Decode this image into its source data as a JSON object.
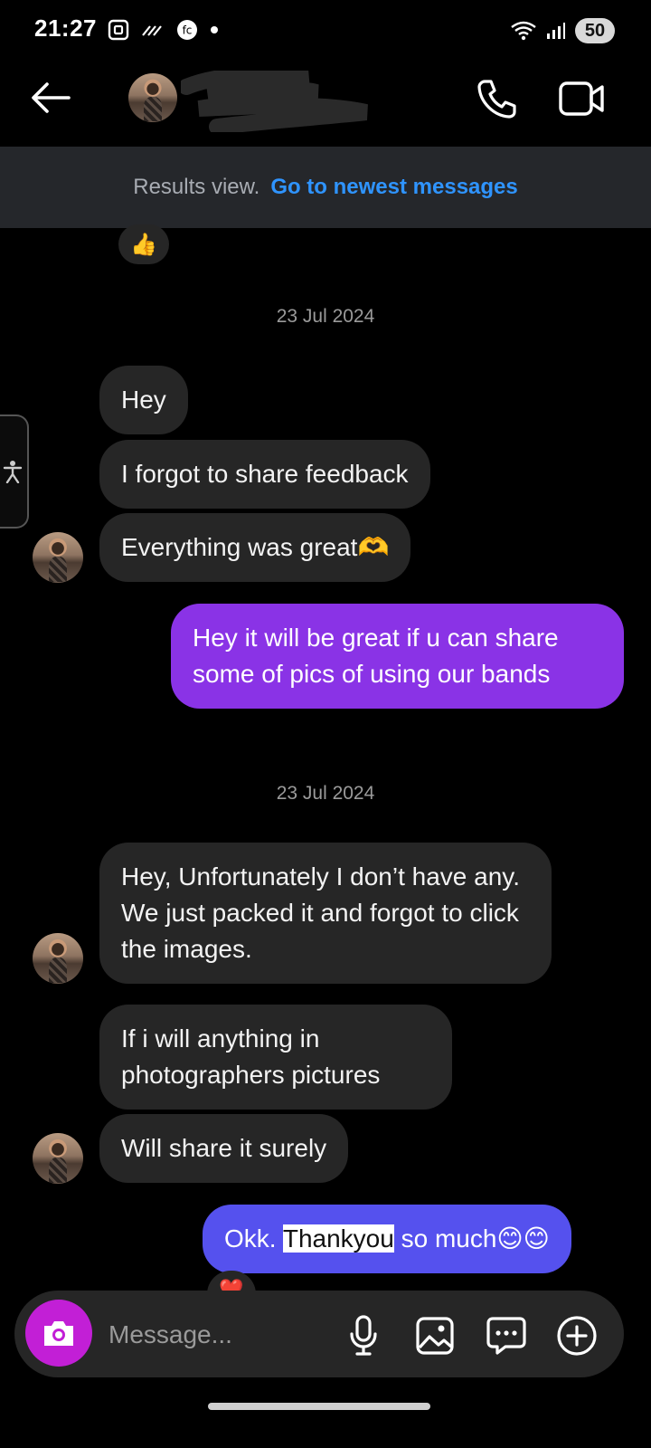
{
  "status_bar": {
    "time": "21:27",
    "battery": "50",
    "icons": [
      "screen-record-icon",
      "wave-icon",
      "fc-icon",
      "dot-icon",
      "wifi-icon",
      "signal-icon"
    ]
  },
  "header": {
    "contact_name": ""
  },
  "banner": {
    "text": "Results view.",
    "link": "Go to newest messages"
  },
  "conversation": {
    "reaction": "👍",
    "dates": [
      "23 Jul 2024",
      "23 Jul 2024"
    ],
    "messages": [
      {
        "from": "them",
        "text": "Hey"
      },
      {
        "from": "them",
        "text": "I forgot to share feedback"
      },
      {
        "from": "them",
        "text": "Everything was great🫶"
      },
      {
        "from": "me",
        "text": "Hey it will be great if u can share some of pics of using our bands"
      },
      {
        "from": "them",
        "text": "Hey, Unfortunately I don’t have any. We just packed it and forgot to click the images."
      },
      {
        "from": "them",
        "text": "If i will anything in photographers pictures"
      },
      {
        "from": "them",
        "text": "Will share it surely"
      },
      {
        "from": "me",
        "prefix": "Okk. ",
        "highlight": "Thankyou",
        "suffix": " so much😊😊"
      }
    ],
    "last_reaction": "❤️"
  },
  "composer": {
    "placeholder": "Message..."
  },
  "colors": {
    "background": "#000000",
    "incoming_bubble": "#262626",
    "outgoing_purple": "#8a33e6",
    "outgoing_blue": "#5551ee",
    "link_blue": "#2f94ff",
    "camera_button": "#c21fd6"
  }
}
